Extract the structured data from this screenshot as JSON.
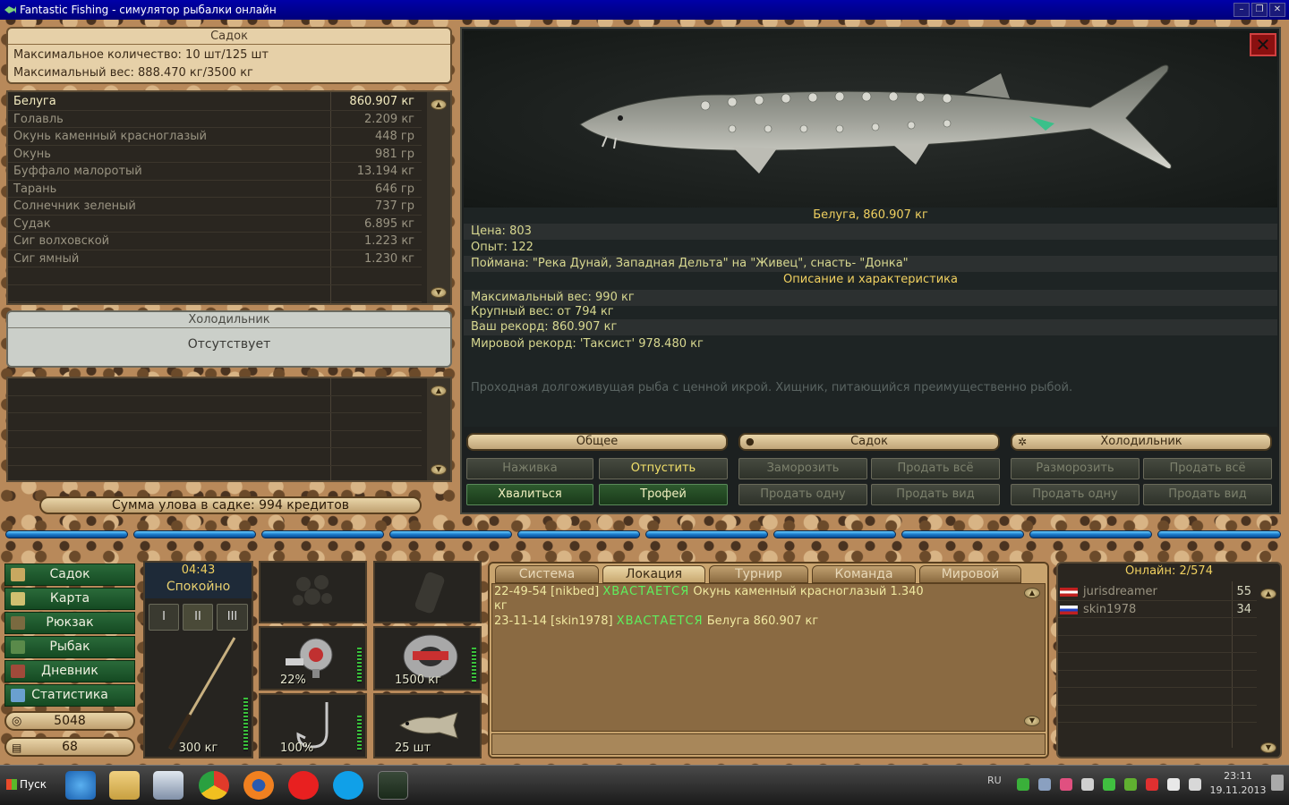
{
  "window": {
    "title": "Fantastic Fishing - симулятор рыбалки онлайн"
  },
  "sadok": {
    "title": "Садок",
    "max_count": "Максимальное количество: 10 шт/125 шт",
    "max_weight": "Максимальный вес: 888.470 кг/3500 кг",
    "fish": [
      {
        "name": "Белуга",
        "weight": "860.907 кг"
      },
      {
        "name": "Голавль",
        "weight": "2.209 кг"
      },
      {
        "name": "Окунь каменный красноглазый",
        "weight": "448 гр"
      },
      {
        "name": "Окунь",
        "weight": "981 гр"
      },
      {
        "name": "Буффало малоротый",
        "weight": "13.194 кг"
      },
      {
        "name": "Тарань",
        "weight": "646 гр"
      },
      {
        "name": "Солнечник зеленый",
        "weight": "737 гр"
      },
      {
        "name": "Судак",
        "weight": "6.895 кг"
      },
      {
        "name": "Сиг волховской",
        "weight": "1.223 кг"
      },
      {
        "name": "Сиг ямный",
        "weight": "1.230 кг"
      }
    ],
    "sum": "Сумма улова в садке: 994 кредитов"
  },
  "fridge": {
    "title": "Холодильник",
    "status": "Отсутствует"
  },
  "details": {
    "header": "Белуга, 860.907 кг",
    "price": "Цена: 803",
    "exp": "Опыт: 122",
    "caught": "Поймана: \"Река Дунай, Западная Дельта\" на \"Живец\", снасть- \"Донка\"",
    "desc_header": "Описание и характеристика",
    "max_weight": "Максимальный вес: 990 кг",
    "big_weight": "Крупный вес: от 794 кг",
    "your_record": "Ваш рекорд: 860.907 кг",
    "world_record": "Мировой рекорд: 'Таксист' 978.480 кг",
    "description": "Проходная долгоживущая рыба с ценной икрой. Хищник, питающийся преимущественно рыбой."
  },
  "actions": {
    "general": {
      "title": "Общее",
      "bait": "Наживка",
      "release": "Отпустить",
      "brag": "Хвалиться",
      "trophy": "Трофей"
    },
    "sadok": {
      "title": "Садок",
      "freeze": "Заморозить",
      "sell_all": "Продать всё",
      "sell_one": "Продать одну",
      "sell_kind": "Продать вид"
    },
    "fridge": {
      "title": "Холодильник",
      "defrost": "Разморозить",
      "sell_all": "Продать всё",
      "sell_one": "Продать одну",
      "sell_kind": "Продать вид"
    }
  },
  "nav": {
    "items": [
      "Садок",
      "Карта",
      "Рюкзак",
      "Рыбак",
      "Дневник",
      "Статистика"
    ],
    "money": "5048",
    "level": "68"
  },
  "status": {
    "time": "04:43",
    "state": "Спокойно",
    "rod_slots": [
      "I",
      "II",
      "III"
    ]
  },
  "tackle": {
    "rod_weight": "300 кг",
    "reel": "22%",
    "line": "1500 кг",
    "hook": "100%",
    "bait": "25 шт"
  },
  "chat": {
    "tabs": [
      "Система",
      "Локация",
      "Турнир",
      "Команда",
      "Мировой"
    ],
    "active_tab": "Локация",
    "messages": [
      {
        "time": "22-49-54",
        "nick": "[nikbed]",
        "action": "ХВАСТАЕТСЯ",
        "text": "Окунь каменный красноглазый 1.340",
        "cont": "кг"
      },
      {
        "time": "23-11-14",
        "nick": "[skin1978]",
        "action": "ХВАСТАЕТСЯ",
        "text": "Белуга 860.907 кг"
      }
    ]
  },
  "online": {
    "title": "Онлайн: 2/574",
    "users": [
      {
        "name": "jurisdreamer",
        "level": "55"
      },
      {
        "name": "skin1978",
        "level": "34"
      }
    ]
  },
  "taskbar": {
    "start": "Пуск",
    "lang": "RU",
    "time": "23:11",
    "date": "19.11.2013"
  },
  "colors": {
    "accent_yellow": "#f2e06a",
    "brag_green": "#5ef05e",
    "nav_green": "#2a6a3a",
    "title_blue": "#0000a8"
  }
}
